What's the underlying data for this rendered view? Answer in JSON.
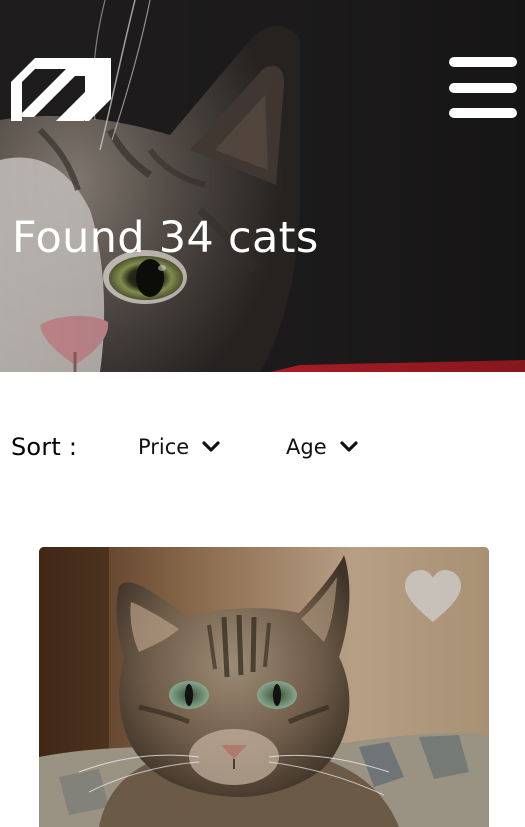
{
  "header": {
    "logo_icon": "brand-logo-icon",
    "menu_icon": "hamburger-menu-icon",
    "title": "Found 34 cats"
  },
  "sort": {
    "label": "Sort :",
    "options": [
      {
        "label": "Price",
        "icon": "chevron-down-icon"
      },
      {
        "label": "Age",
        "icon": "chevron-down-icon"
      }
    ]
  },
  "results": [
    {
      "favorite_icon": "heart-icon"
    }
  ],
  "colors": {
    "hero_background": "#1f1d1d",
    "text_on_hero": "#ffffff",
    "accent_red": "#c0202a",
    "favorite_icon": "#cfcfcf"
  }
}
